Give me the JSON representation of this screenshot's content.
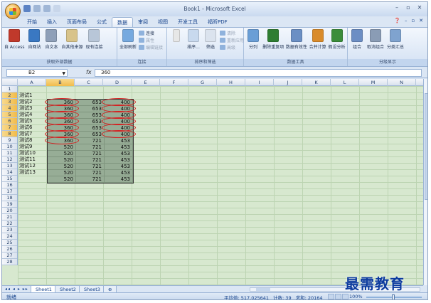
{
  "window": {
    "title": "Book1 - Microsoft Excel"
  },
  "ribbon_tabs": [
    "开始",
    "插入",
    "页面布局",
    "公式",
    "数据",
    "审阅",
    "视图",
    "开发工具",
    "福昕PDF"
  ],
  "active_tab": "数据",
  "ribbon_groups": {
    "external": {
      "caption": "获取外部数据",
      "buttons": [
        "自 Access",
        "自网站",
        "自文本",
        "自其他来源",
        "现有连接"
      ]
    },
    "connections": {
      "caption": "连接",
      "big": "全部刷新",
      "small": [
        "连接",
        "属性",
        "编辑链接"
      ]
    },
    "sort": {
      "caption": "排序和筛选",
      "buttons": [
        "排序...",
        "筛选"
      ],
      "small": [
        "清除",
        "重新应用",
        "高级"
      ]
    },
    "tools": {
      "caption": "数据工具",
      "buttons": [
        "分列",
        "删除重复项",
        "数据有效性",
        "合并计算",
        "假设分析"
      ]
    },
    "outline": {
      "caption": "分级显示",
      "buttons": [
        "组合",
        "取消组合",
        "分类汇总"
      ]
    }
  },
  "formula_bar": {
    "name_box": "B2",
    "fx": "fx",
    "value": "360"
  },
  "columns": [
    "A",
    "B",
    "C",
    "D",
    "E",
    "F",
    "G",
    "H",
    "I",
    "J",
    "K",
    "L",
    "M",
    "N"
  ],
  "rows": [
    "1",
    "2",
    "3",
    "4",
    "5",
    "6",
    "7",
    "8",
    "9",
    "10",
    "11",
    "12",
    "13",
    "14",
    "15",
    "16",
    "17",
    "18",
    "19",
    "20",
    "21",
    "22",
    "23",
    "24",
    "25",
    "26",
    "27",
    "28"
  ],
  "row_labels": [
    "",
    "测试1",
    "测试2",
    "测试3",
    "测试4",
    "测试5",
    "测试6",
    "测试7",
    "测试8",
    "测试9",
    "测试10",
    "测试11",
    "测试12",
    "测试13"
  ],
  "table": [
    [
      "360",
      "653",
      "400"
    ],
    [
      "360",
      "653",
      "400"
    ],
    [
      "360",
      "653",
      "400"
    ],
    [
      "360",
      "653",
      "400"
    ],
    [
      "360",
      "653",
      "400"
    ],
    [
      "360",
      "653",
      "400"
    ],
    [
      "360",
      "721",
      "453"
    ],
    [
      "520",
      "721",
      "453"
    ],
    [
      "520",
      "721",
      "453"
    ],
    [
      "520",
      "721",
      "453"
    ],
    [
      "520",
      "721",
      "453"
    ],
    [
      "520",
      "721",
      "453"
    ],
    [
      "520",
      "721",
      "453"
    ]
  ],
  "sheet_tabs": [
    "Sheet1",
    "Sheet2",
    "Sheet3"
  ],
  "status": {
    "ready": "就绪",
    "average": "平均值: 517.025641",
    "count": "计数: 39",
    "sum": "求和: 20164",
    "zoom": "100%"
  },
  "watermark": "最需教育"
}
